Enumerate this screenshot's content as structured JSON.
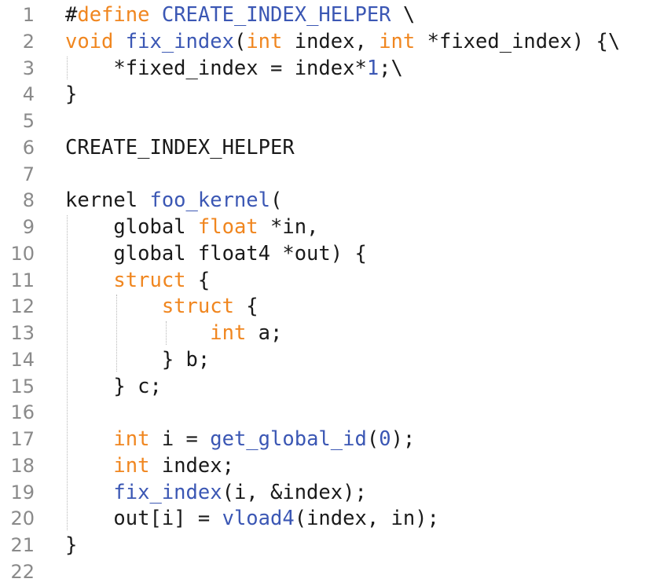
{
  "colors": {
    "background": "#ffffff",
    "line_number": "#8a8a8a",
    "plain": "#1a1a1a",
    "keyword": "#f0861f",
    "function": "#3b57b4",
    "number": "#3b57b4"
  },
  "editor": {
    "lines": [
      {
        "number": "1",
        "tokens": [
          {
            "t": "#",
            "k": "plain"
          },
          {
            "t": "define",
            "k": "keyword"
          },
          {
            "t": " ",
            "k": "plain"
          },
          {
            "t": "CREATE_INDEX_HELPER",
            "k": "func"
          },
          {
            "t": " \\",
            "k": "plain"
          }
        ]
      },
      {
        "number": "2",
        "tokens": [
          {
            "t": "void",
            "k": "keyword"
          },
          {
            "t": " ",
            "k": "plain"
          },
          {
            "t": "fix_index",
            "k": "func"
          },
          {
            "t": "(",
            "k": "plain"
          },
          {
            "t": "int",
            "k": "keyword"
          },
          {
            "t": " index, ",
            "k": "plain"
          },
          {
            "t": "int",
            "k": "keyword"
          },
          {
            "t": " *fixed_index) {\\",
            "k": "plain"
          }
        ]
      },
      {
        "number": "3",
        "tokens": [
          {
            "t": "    *fixed_index = index*",
            "k": "plain"
          },
          {
            "t": "1",
            "k": "number"
          },
          {
            "t": ";\\",
            "k": "plain"
          }
        ]
      },
      {
        "number": "4",
        "tokens": [
          {
            "t": "}",
            "k": "plain"
          }
        ]
      },
      {
        "number": "5",
        "tokens": []
      },
      {
        "number": "6",
        "tokens": [
          {
            "t": "CREATE_INDEX_HELPER",
            "k": "plain"
          }
        ]
      },
      {
        "number": "7",
        "tokens": []
      },
      {
        "number": "8",
        "tokens": [
          {
            "t": "kernel ",
            "k": "plain"
          },
          {
            "t": "foo_kernel",
            "k": "func"
          },
          {
            "t": "(",
            "k": "plain"
          }
        ]
      },
      {
        "number": "9",
        "tokens": [
          {
            "t": "    global ",
            "k": "plain"
          },
          {
            "t": "float",
            "k": "keyword"
          },
          {
            "t": " *in,",
            "k": "plain"
          }
        ]
      },
      {
        "number": "10",
        "tokens": [
          {
            "t": "    global float4 *out) {",
            "k": "plain"
          }
        ]
      },
      {
        "number": "11",
        "tokens": [
          {
            "t": "    ",
            "k": "plain"
          },
          {
            "t": "struct",
            "k": "keyword"
          },
          {
            "t": " {",
            "k": "plain"
          }
        ]
      },
      {
        "number": "12",
        "tokens": [
          {
            "t": "        ",
            "k": "plain"
          },
          {
            "t": "struct",
            "k": "keyword"
          },
          {
            "t": " {",
            "k": "plain"
          }
        ]
      },
      {
        "number": "13",
        "tokens": [
          {
            "t": "            ",
            "k": "plain"
          },
          {
            "t": "int",
            "k": "keyword"
          },
          {
            "t": " a;",
            "k": "plain"
          }
        ]
      },
      {
        "number": "14",
        "tokens": [
          {
            "t": "        } b;",
            "k": "plain"
          }
        ]
      },
      {
        "number": "15",
        "tokens": [
          {
            "t": "    } c;",
            "k": "plain"
          }
        ]
      },
      {
        "number": "16",
        "tokens": []
      },
      {
        "number": "17",
        "tokens": [
          {
            "t": "    ",
            "k": "plain"
          },
          {
            "t": "int",
            "k": "keyword"
          },
          {
            "t": " i = ",
            "k": "plain"
          },
          {
            "t": "get_global_id",
            "k": "func"
          },
          {
            "t": "(",
            "k": "plain"
          },
          {
            "t": "0",
            "k": "number"
          },
          {
            "t": ");",
            "k": "plain"
          }
        ]
      },
      {
        "number": "18",
        "tokens": [
          {
            "t": "    ",
            "k": "plain"
          },
          {
            "t": "int",
            "k": "keyword"
          },
          {
            "t": " index;",
            "k": "plain"
          }
        ]
      },
      {
        "number": "19",
        "tokens": [
          {
            "t": "    ",
            "k": "plain"
          },
          {
            "t": "fix_index",
            "k": "func"
          },
          {
            "t": "(i, &index);",
            "k": "plain"
          }
        ]
      },
      {
        "number": "20",
        "tokens": [
          {
            "t": "    out[i] = ",
            "k": "plain"
          },
          {
            "t": "vload4",
            "k": "func"
          },
          {
            "t": "(index, in);",
            "k": "plain"
          }
        ]
      },
      {
        "number": "21",
        "tokens": [
          {
            "t": "}",
            "k": "plain"
          }
        ]
      },
      {
        "number": "22",
        "tokens": []
      }
    ]
  }
}
